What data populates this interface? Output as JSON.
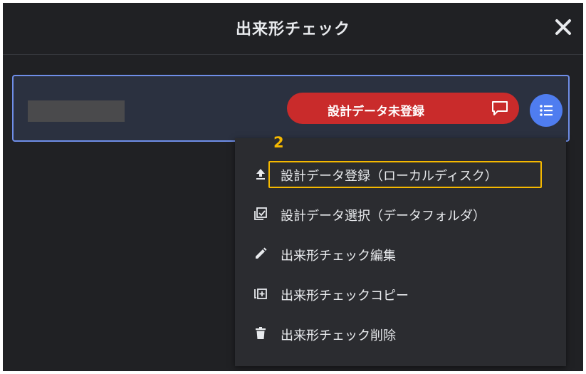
{
  "dialog": {
    "title": "出来形チェック",
    "close_icon": "close-icon"
  },
  "card": {
    "status_label": "設計データ未登録",
    "status_color": "#c92b2b",
    "comment_icon": "comment-icon",
    "menu_icon": "list-icon",
    "accent_color": "#4f7df0"
  },
  "annotation": {
    "step_number": "2",
    "highlight_color": "#f5b800"
  },
  "menu": {
    "items": [
      {
        "label": "設計データ登録（ローカルディスク）",
        "icon": "upload-icon"
      },
      {
        "label": "設計データ選択（データフォルダ）",
        "icon": "select-checkbox-icon"
      },
      {
        "label": "出来形チェック編集",
        "icon": "pencil-icon"
      },
      {
        "label": "出来形チェックコピー",
        "icon": "copy-icon"
      },
      {
        "label": "出来形チェック削除",
        "icon": "trash-icon"
      }
    ]
  }
}
